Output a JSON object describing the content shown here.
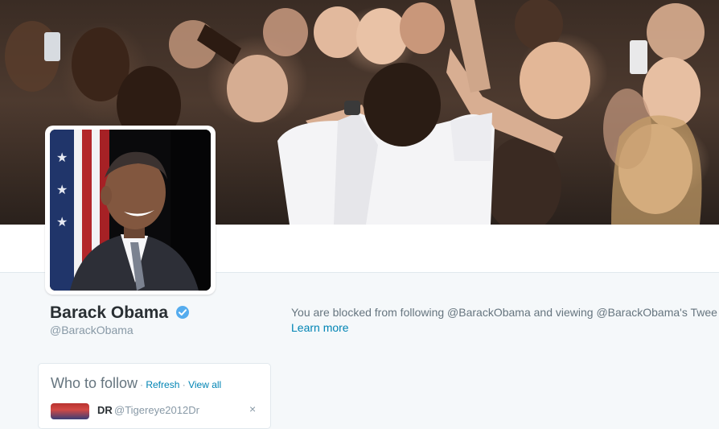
{
  "profile": {
    "name": "Barack Obama",
    "handle": "@BarackObama",
    "verified": true
  },
  "blocked_notice": {
    "text": "You are blocked from following @BarackObama and viewing @BarackObama's Twee",
    "learn_more": "Learn more"
  },
  "who_to_follow": {
    "title": "Who to follow",
    "separator": "·",
    "refresh_label": "Refresh",
    "view_all_label": "View all",
    "suggestion": {
      "name": "DR",
      "handle": "@Tigereye2012Dr",
      "dismiss_icon": "close-icon"
    }
  },
  "colors": {
    "link": "#0084b4",
    "verified": "#55acee",
    "name": "#292f33",
    "muted": "#8899a6",
    "page_bg": "#f5f8fa"
  },
  "icons": {
    "verified": "verified-badge-icon"
  }
}
